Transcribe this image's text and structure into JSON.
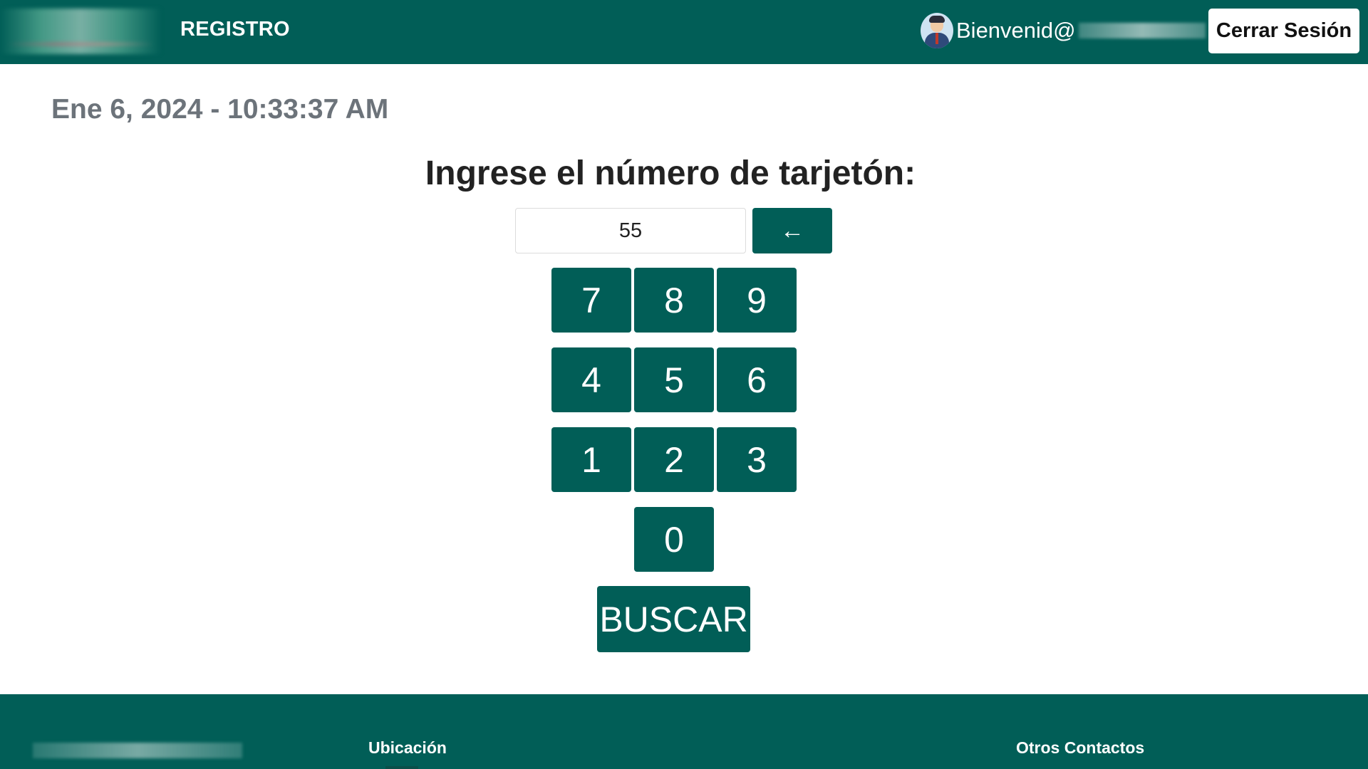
{
  "header": {
    "title": "REGISTRO",
    "welcome_text": "Bienvenid@",
    "logout_label": "Cerrar Sesión"
  },
  "main": {
    "datetime": "Ene 6, 2024 - 10:33:37 AM",
    "prompt": "Ingrese el número de tarjetón:",
    "input_value": "55",
    "backspace_label": "←",
    "keys": [
      "7",
      "8",
      "9",
      "4",
      "5",
      "6",
      "1",
      "2",
      "3",
      "0"
    ],
    "search_label": "BUSCAR"
  },
  "footer": {
    "location_heading": "Ubicación",
    "contacts_heading": "Otros Contactos"
  },
  "colors": {
    "primary": "#015e57",
    "text_muted": "#6c737a"
  }
}
